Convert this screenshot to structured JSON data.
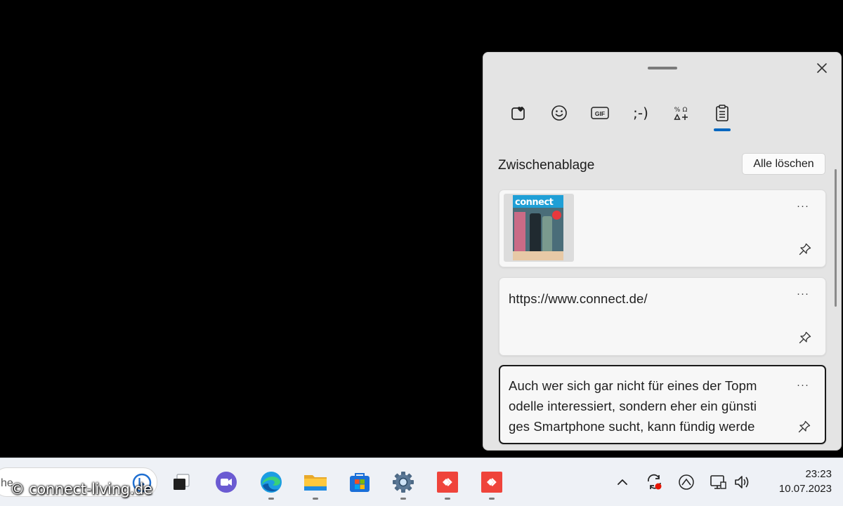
{
  "clipboard_panel": {
    "tabs": [
      {
        "name": "kaomoji-favorites",
        "icon": "favorites-heart-icon"
      },
      {
        "name": "emoji",
        "icon": "emoji-smiley-icon"
      },
      {
        "name": "gif",
        "icon": "gif-icon",
        "label": "GIF"
      },
      {
        "name": "kaomoji",
        "icon": "kaomoji-icon",
        "label": ";-)"
      },
      {
        "name": "symbols",
        "icon": "symbols-icon"
      },
      {
        "name": "clipboard",
        "icon": "clipboard-icon",
        "active": true
      }
    ],
    "title": "Zwischenablage",
    "clear_all_label": "Alle löschen",
    "items": [
      {
        "type": "image",
        "thumbnail_text": "connect"
      },
      {
        "type": "text",
        "text": "https://www.connect.de/"
      },
      {
        "type": "text",
        "text": "Auch wer sich gar nicht für eines der Topm\nodelle interessiert, sondern eher ein günsti\nges Smartphone sucht, kann fündig werde",
        "selected": true
      }
    ],
    "more_label": "···"
  },
  "taskbar": {
    "search_text": "he",
    "watermark": "© connect-living.de",
    "apps": [
      {
        "name": "task-view"
      },
      {
        "name": "teams-chat"
      },
      {
        "name": "edge",
        "running": true
      },
      {
        "name": "file-explorer",
        "running": true
      },
      {
        "name": "microsoft-store"
      },
      {
        "name": "settings",
        "running": true
      },
      {
        "name": "anydesk-1",
        "running": true
      },
      {
        "name": "anydesk-2",
        "running": true
      }
    ],
    "tray": {
      "chevron_label": "^",
      "time": "23:23",
      "date": "10.07.2023"
    }
  },
  "colors": {
    "accent": "#0067c0",
    "anydesk_red": "#ef443b",
    "panel_bg": "#e4e4e4"
  }
}
